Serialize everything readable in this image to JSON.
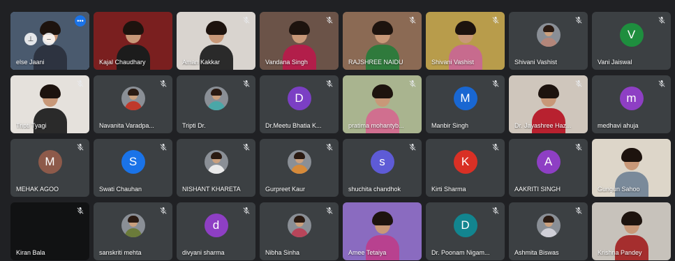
{
  "colors": {
    "background": "#202124",
    "tile": "#3c4043",
    "text": "#ffffff",
    "accent": "#1a73e8"
  },
  "tiles": [
    {
      "name": "else Jaani",
      "type": "video",
      "muted": false,
      "selected": true,
      "bg": "#4a5a6e",
      "shirt": "#2d3340"
    },
    {
      "name": "Kajal Chaudhary",
      "type": "video",
      "muted": false,
      "bg": "#7a1f1f",
      "shirt": "#1c1c1c"
    },
    {
      "name": "Aman Kakkar",
      "type": "video",
      "muted": true,
      "bg": "#d9d4cf",
      "shirt": "#2a2a2a"
    },
    {
      "name": "Vandana Singh",
      "type": "video",
      "muted": true,
      "bg": "#6b5348",
      "shirt": "#b21e4a"
    },
    {
      "name": "RAJSHREE NAIDU",
      "type": "video",
      "muted": true,
      "bg": "#8b6a54",
      "shirt": "#2f7a3c"
    },
    {
      "name": "Shivani Vashist",
      "type": "video",
      "muted": true,
      "bg": "#b89c4b",
      "shirt": "#c76b8e"
    },
    {
      "name": "Shivani Vashist",
      "type": "photo",
      "muted": true,
      "body": "#b3867a"
    },
    {
      "name": "Vani Jaiswal",
      "type": "letter",
      "letter": "V",
      "color": "#1e8e3e",
      "muted": true
    },
    {
      "name": "Tripti Tyagi",
      "type": "video",
      "muted": true,
      "bg": "#e5e1dc",
      "shirt": "#2a2a2a"
    },
    {
      "name": "Navanita Varadpa...",
      "type": "photo",
      "muted": true,
      "body": "#c0392b"
    },
    {
      "name": "Tripti Dr.",
      "type": "photo",
      "muted": true,
      "body": "#4aa7a8"
    },
    {
      "name": "Dr.Meetu Bhatia K...",
      "type": "letter",
      "letter": "D",
      "color": "#7b3fc4",
      "muted": true
    },
    {
      "name": "pratima mohantyb...",
      "type": "video",
      "muted": true,
      "bg": "#a9b48f",
      "shirt": "#d06f8f"
    },
    {
      "name": "Manbir Singh",
      "type": "letter",
      "letter": "M",
      "color": "#1967d2",
      "muted": true
    },
    {
      "name": "Dr. Jayashree Haz...",
      "type": "video",
      "muted": true,
      "bg": "#cfc6bc",
      "shirt": "#b8212f"
    },
    {
      "name": "medhavi ahuja",
      "type": "letter",
      "letter": "m",
      "color": "#8e3fc4",
      "muted": true
    },
    {
      "name": "MEHAK AGOO",
      "type": "letter",
      "letter": "M",
      "color": "#8d5a4a",
      "muted": true
    },
    {
      "name": "Swati Chauhan",
      "type": "letter",
      "letter": "S",
      "color": "#1a73e8",
      "muted": true
    },
    {
      "name": "NISHANT KHARETA",
      "type": "photo",
      "muted": true,
      "body": "#e9e9e9"
    },
    {
      "name": "Gurpreet Kaur",
      "type": "photo",
      "muted": true,
      "body": "#d68a3a"
    },
    {
      "name": "shuchita chandhok",
      "type": "letter",
      "letter": "s",
      "color": "#5e5bd6",
      "muted": true
    },
    {
      "name": "Kirti Sharma",
      "type": "letter",
      "letter": "K",
      "color": "#d93025",
      "muted": true
    },
    {
      "name": "AAKRITI SINGH",
      "type": "letter",
      "letter": "A",
      "color": "#8e3fc4",
      "muted": true
    },
    {
      "name": "Gungun Sahoo",
      "type": "video",
      "muted": false,
      "bg": "#ddd6c9",
      "shirt": "#7a8a9a"
    },
    {
      "name": "Kiran Bala",
      "type": "blank",
      "muted": true
    },
    {
      "name": "sanskriti mehta",
      "type": "photo",
      "muted": true,
      "body": "#6b7b3a"
    },
    {
      "name": "divyani sharma",
      "type": "letter",
      "letter": "d",
      "color": "#8e3fc4",
      "muted": true
    },
    {
      "name": "Nibha Sinha",
      "type": "photo",
      "muted": true,
      "body": "#b8455a"
    },
    {
      "name": "Amee Tetaiya",
      "type": "video",
      "muted": false,
      "bg": "#8a6bc0",
      "shirt": "#b8418f"
    },
    {
      "name": "Dr. Poonam Nigam...",
      "type": "letter",
      "letter": "D",
      "color": "#12858f",
      "muted": true
    },
    {
      "name": "Ashmita Biswas",
      "type": "photo",
      "muted": true,
      "body": "#d0d0d8"
    },
    {
      "name": "Krishna Pandey",
      "type": "video",
      "muted": false,
      "bg": "#c7c2bb",
      "shirt": "#a52e2e"
    }
  ],
  "self_controls": {
    "pin_icon": "pin-icon",
    "minimize_icon": "minimize-icon",
    "more_icon": "more-options-icon"
  }
}
